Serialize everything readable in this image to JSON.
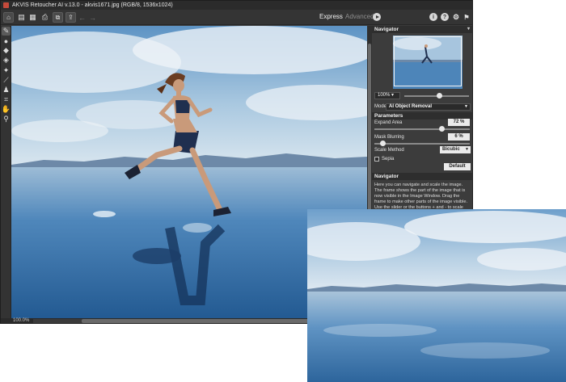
{
  "window": {
    "title": "AKVIS Retoucher AI v.13.0 - akvis1671.jpg (RGB/8, 1536x1024)",
    "controls": [
      "–",
      "□",
      "✕"
    ]
  },
  "toolbar": {
    "modes": {
      "express": "Express",
      "advanced": "Advanced"
    },
    "icons": [
      "home-icon",
      "open-icon",
      "save-icon",
      "print-icon",
      "batch-icon",
      "share-icon",
      "undo-icon",
      "redo-icon",
      "run-icon",
      "info-icon",
      "help-icon",
      "settings-icon",
      "notice-icon"
    ],
    "glyphs": {
      "info": "i",
      "help": "?",
      "settings": "⚙",
      "notice": "⚑"
    }
  },
  "tools": [
    "brush-tool-icon",
    "selection-brush-icon",
    "eraser-icon",
    "bucket-icon",
    "magic-wand-icon",
    "pipette-icon",
    "stamp-icon",
    "crop-icon",
    "hand-icon",
    "zoom-icon"
  ],
  "status": {
    "zoom": "100.0%"
  },
  "panel": {
    "navigator_title": "Navigator",
    "zoom_value": "100%",
    "mode_label": "Mode:",
    "mode_value": "AI Object Removal",
    "parameters_title": "Parameters",
    "expand_area_label": "Expand Area",
    "expand_area_value": "72 %",
    "expand_area_level": 0.72,
    "mask_blurring_label": "Mask Blurring",
    "mask_blurring_value": "6 %",
    "mask_blurring_level": 0.06,
    "scale_method_label": "Scale Method",
    "scale_method_value": "Bicubic",
    "sepia_label": "Sepia",
    "default_button": "Default",
    "help_title": "Navigator",
    "help_text": "Here you can navigate and scale the image. The frame shows the part of the image that is now visible in the Image Window. Drag the frame to make other parts of the image visible. Use the slider or the buttons + and - to scale the image. The fall-down menu shows some frequently used"
  },
  "colors": {
    "accent_logo": "#c44a3b",
    "window_bg": "#3a3a3a",
    "panel_bg": "#3c3c3c"
  }
}
